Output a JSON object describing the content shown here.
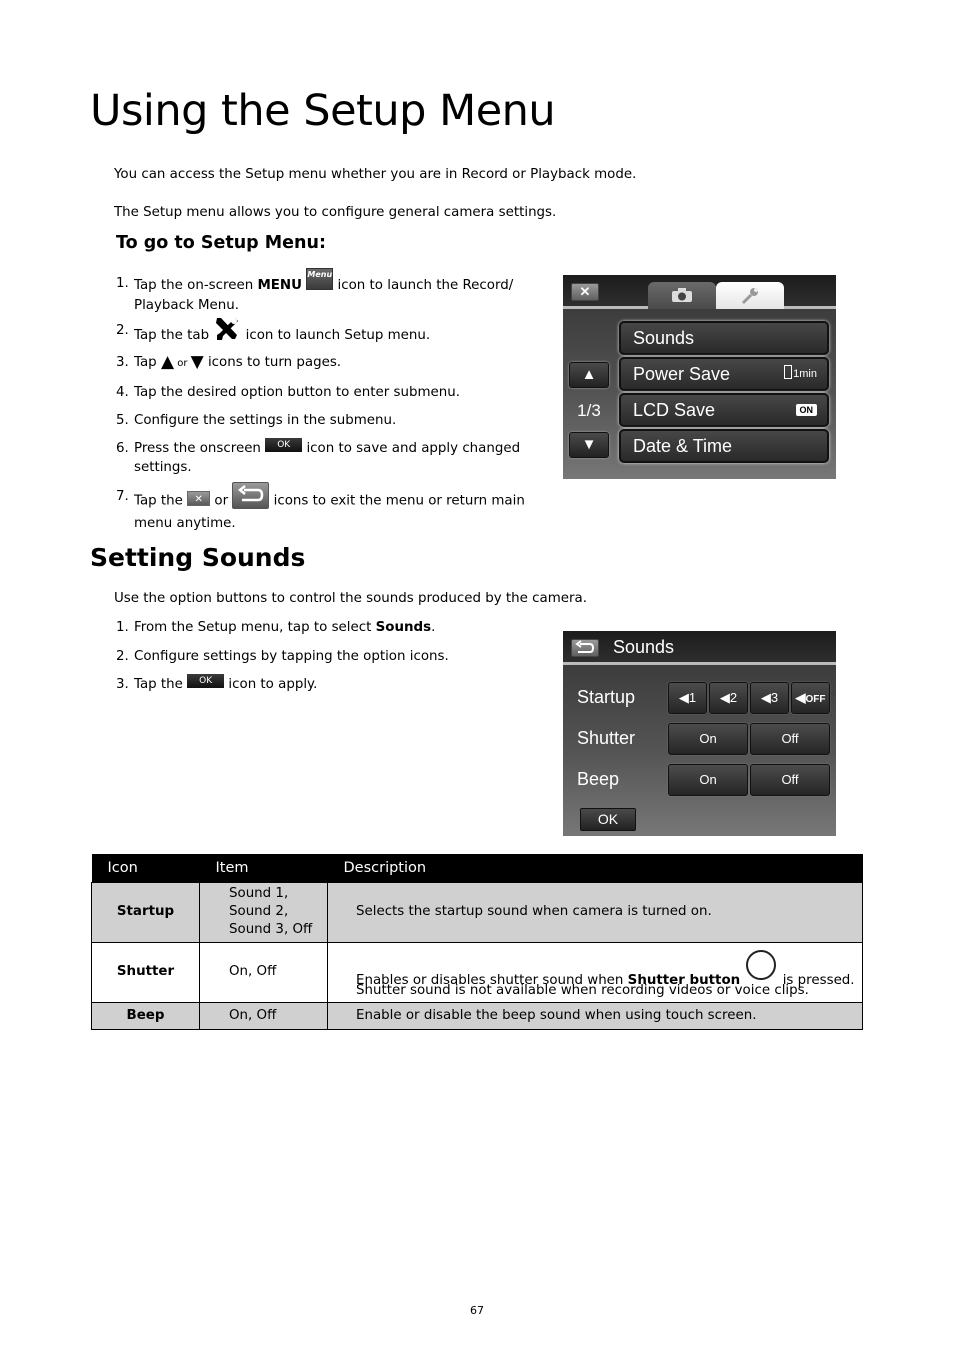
{
  "title": "Using the Setup Menu",
  "intro": [
    "You can access the Setup menu whether you are in Record or Playback mode.",
    "The Setup menu allows you to configure general camera settings."
  ],
  "goto_heading": "To go to Setup Menu:",
  "steps": [
    {
      "num": "1.",
      "pre": "Tap the on-screen ",
      "bold": "MENU",
      "icon": "menu-icon",
      "icon_label": "Menu",
      "post": " icon to launch the Record/ Playback Menu."
    },
    {
      "num": "2.",
      "pre": "Tap the tab ",
      "icon": "tools-icon",
      "post": " icon to launch Setup menu."
    },
    {
      "num": "3.",
      "pre": "Tap ",
      "icon": "up-triangle-icon",
      "mid": " or ",
      "icon2": "down-triangle-icon",
      "post": " icons to turn pages."
    },
    {
      "num": "4.",
      "text": "Tap the desired option button to enter submenu."
    },
    {
      "num": "5.",
      "text": "Configure the settings in the submenu."
    },
    {
      "num": "6.",
      "pre": "Press the onscreen ",
      "icon": "ok-icon",
      "icon_label": "OK",
      "post": " icon to save and apply changed settings."
    },
    {
      "num": "7.",
      "pre": "Tap the ",
      "icon": "close-icon",
      "icon_label": "✕",
      "mid": " or ",
      "icon2": "return-icon",
      "post": " icons to exit the menu or return main menu anytime."
    }
  ],
  "setup_screen": {
    "close_label": "✕",
    "tabs": [
      {
        "name": "camera-tab",
        "icon": "camera-icon"
      },
      {
        "name": "setup-tab",
        "icon": "wrench-icon",
        "active": true
      }
    ],
    "menu_items": [
      {
        "label": "Sounds"
      },
      {
        "label": "Power Save",
        "value": "1min"
      },
      {
        "label": "LCD Save",
        "value": "ON"
      },
      {
        "label": "Date & Time"
      }
    ],
    "page_up": "▲",
    "page_down": "▼",
    "page_indicator": "1/3"
  },
  "section2": {
    "title": "Setting Sounds",
    "intro": "Use the option buttons to control the sounds produced by the camera.",
    "steps": [
      {
        "num": "1.",
        "pre": "From the Setup menu, tap to select ",
        "bold": "Sounds",
        "post": "."
      },
      {
        "num": "2.",
        "text": "Configure settings by tapping the option icons."
      },
      {
        "num": "3.",
        "pre": "Tap the ",
        "icon": "ok-icon",
        "icon_label": "OK",
        "post": " icon to apply."
      }
    ]
  },
  "sounds_screen": {
    "title": "Sounds",
    "rows": [
      {
        "label": "Startup",
        "options": [
          "1",
          "2",
          "3",
          "OFF"
        ]
      },
      {
        "label": "Shutter",
        "options": [
          "On",
          "Off"
        ]
      },
      {
        "label": "Beep",
        "options": [
          "On",
          "Off"
        ]
      }
    ],
    "ok_label": "OK"
  },
  "table": {
    "headers": [
      "Icon",
      "Item",
      "Description"
    ],
    "rows": [
      {
        "icon": "Startup",
        "item_lines": [
          "Sound 1,",
          "Sound 2,",
          "Sound 3, Off"
        ],
        "description": "Selects the startup sound when camera is turned on."
      },
      {
        "icon": "Shutter",
        "item": "On, Off",
        "desc_pre": "Enables or disables shutter sound when ",
        "desc_bold": "Shutter button",
        "desc_post": " is pressed.",
        "desc_line2": "Shutter sound is not available when recording videos or voice clips."
      },
      {
        "icon": "Beep",
        "item": "On, Off",
        "description": "Enable or disable the beep sound when using touch screen."
      }
    ]
  },
  "page_number": "67"
}
